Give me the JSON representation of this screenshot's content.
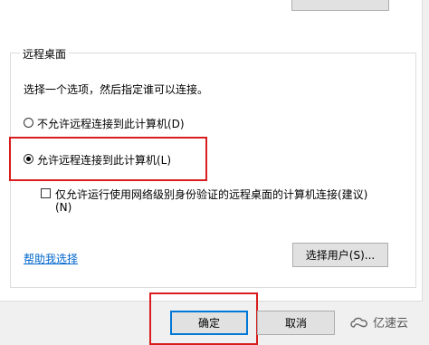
{
  "group": {
    "title": "远程桌面",
    "instruction": "选择一个选项，然后指定谁可以连接。"
  },
  "options": {
    "deny_label": "不允许远程连接到此计算机(D)",
    "allow_label": "允许远程连接到此计算机(L)",
    "allow_selected": true,
    "nla_line1": "仅允许运行使用网络级别身份验证的远程桌面的计算机连接(建议)",
    "nla_line2": "(N)",
    "nla_checked": false
  },
  "links": {
    "help": "帮助我选择"
  },
  "buttons": {
    "select_users": "选择用户(S)...",
    "ok": "确定",
    "cancel": "取消"
  },
  "watermark": {
    "text": "亿速云"
  },
  "colors": {
    "highlight": "#d81e1e",
    "link": "#0066cc",
    "primary_border": "#0078d7"
  }
}
